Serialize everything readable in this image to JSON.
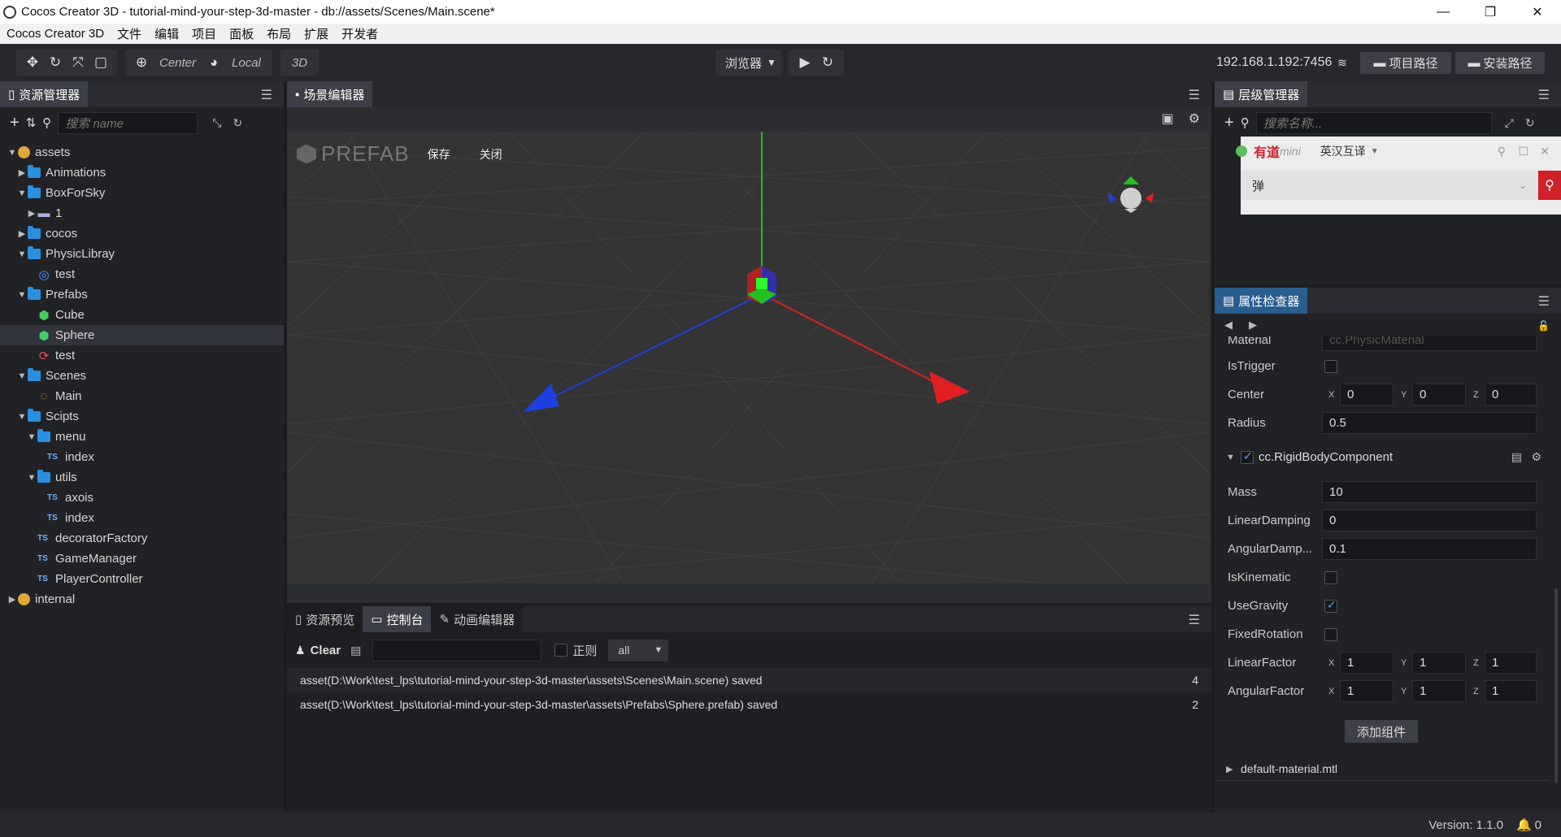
{
  "window": {
    "title": "Cocos Creator 3D - tutorial-mind-your-step-3d-master - db://assets/Scenes/Main.scene*",
    "minimize": "—",
    "maximize": "❐",
    "close": "✕"
  },
  "menu": [
    "Cocos Creator 3D",
    "文件",
    "编辑",
    "项目",
    "面板",
    "布局",
    "扩展",
    "开发者"
  ],
  "toolbar": {
    "pivot": "Center",
    "coord": "Local",
    "mode": "3D",
    "preview_target": "浏览器",
    "ip": "192.168.1.192:7456",
    "project_path_btn": "项目路径",
    "install_path_btn": "安装路径"
  },
  "assets": {
    "tab": "资源管理器",
    "search_placeholder": "搜索 name",
    "items": [
      {
        "label": "assets",
        "depth": 0,
        "type": "db",
        "open": true
      },
      {
        "label": "Animations",
        "depth": 1,
        "type": "folder",
        "open": false
      },
      {
        "label": "BoxForSky",
        "depth": 1,
        "type": "folder",
        "open": true
      },
      {
        "label": "1",
        "depth": 2,
        "type": "texture",
        "open": false
      },
      {
        "label": "cocos",
        "depth": 1,
        "type": "folder",
        "open": false
      },
      {
        "label": "PhysicLibray",
        "depth": 1,
        "type": "folder",
        "open": true
      },
      {
        "label": "test",
        "depth": 2,
        "type": "physic",
        "open": null
      },
      {
        "label": "Prefabs",
        "depth": 1,
        "type": "folder",
        "open": true
      },
      {
        "label": "Cube",
        "depth": 2,
        "type": "prefab",
        "open": null
      },
      {
        "label": "Sphere",
        "depth": 2,
        "type": "prefab",
        "open": null
      },
      {
        "label": "test",
        "depth": 2,
        "type": "anim",
        "open": null
      },
      {
        "label": "Scenes",
        "depth": 1,
        "type": "folder",
        "open": true
      },
      {
        "label": "Main",
        "depth": 2,
        "type": "scene",
        "open": null
      },
      {
        "label": "Scipts",
        "depth": 1,
        "type": "folder",
        "open": true
      },
      {
        "label": "menu",
        "depth": 2,
        "type": "folder",
        "open": true
      },
      {
        "label": "index",
        "depth": 3,
        "type": "ts",
        "open": null
      },
      {
        "label": "utils",
        "depth": 2,
        "type": "folder",
        "open": true
      },
      {
        "label": "axois",
        "depth": 3,
        "type": "ts",
        "open": null
      },
      {
        "label": "index",
        "depth": 3,
        "type": "ts",
        "open": null
      },
      {
        "label": "decoratorFactory",
        "depth": 2,
        "type": "ts",
        "open": null
      },
      {
        "label": "GameManager",
        "depth": 2,
        "type": "ts",
        "open": null
      },
      {
        "label": "PlayerController",
        "depth": 2,
        "type": "ts",
        "open": null
      },
      {
        "label": "internal",
        "depth": 0,
        "type": "db",
        "open": false
      }
    ],
    "selected_index": 9
  },
  "scene": {
    "tab": "场景编辑器",
    "prefab_label": "PREFAB",
    "save": "保存",
    "close": "关闭"
  },
  "console": {
    "tabs": [
      "资源预览",
      "控制台",
      "动画编辑器"
    ],
    "active_tab": 1,
    "clear": "Clear",
    "regex_label": "正则",
    "level": "all",
    "logs": [
      {
        "text": "asset(D:\\Work\\test_lps\\tutorial-mind-your-step-3d-master\\assets\\Scenes\\Main.scene) saved",
        "count": "4"
      },
      {
        "text": "asset(D:\\Work\\test_lps\\tutorial-mind-your-step-3d-master\\assets\\Prefabs\\Sphere.prefab) saved",
        "count": "2"
      }
    ]
  },
  "hierarchy": {
    "tab": "层级管理器",
    "search_placeholder": "搜索名称..."
  },
  "dict_popup": {
    "brand": "有道",
    "brand_sub": "mini",
    "mode": "英汉互译",
    "query": "弹"
  },
  "inspector": {
    "tab": "属性检查器",
    "material_label": "Material",
    "material_value": "cc.PhysicMaterial",
    "is_trigger": {
      "label": "IsTrigger",
      "checked": false
    },
    "center": {
      "label": "Center",
      "x": "0",
      "y": "0",
      "z": "0"
    },
    "radius": {
      "label": "Radius",
      "value": "0.5"
    },
    "component": "cc.RigidBodyComponent",
    "mass": {
      "label": "Mass",
      "value": "10"
    },
    "linear_damping": {
      "label": "LinearDamping",
      "value": "0"
    },
    "angular_damping": {
      "label": "AngularDamp...",
      "value": "0.1"
    },
    "is_kinematic": {
      "label": "IsKinematic",
      "checked": false
    },
    "use_gravity": {
      "label": "UseGravity",
      "checked": true
    },
    "fixed_rotation": {
      "label": "FixedRotation",
      "checked": false
    },
    "linear_factor": {
      "label": "LinearFactor",
      "x": "1",
      "y": "1",
      "z": "1"
    },
    "angular_factor": {
      "label": "AngularFactor",
      "x": "1",
      "y": "1",
      "z": "1"
    },
    "add_component": "添加组件",
    "material_asset": "default-material.mtl",
    "xyz": [
      "X",
      "Y",
      "Z"
    ]
  },
  "statusbar": {
    "version": "Version: 1.1.0",
    "notifications": "0"
  },
  "colors": {
    "accent": "#3a8ee6",
    "x_axis": "#e02020",
    "y_axis": "#20c020",
    "z_axis": "#1f3fe0",
    "panel": "#212226",
    "bg": "#1b1d22"
  }
}
